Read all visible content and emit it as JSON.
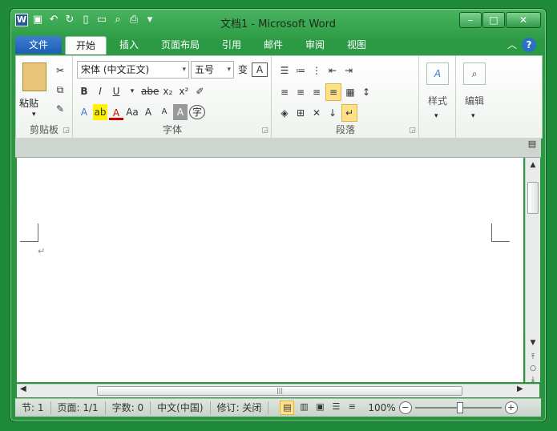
{
  "window": {
    "title": "文档1 - Microsoft Word",
    "minimize_icon": "minimize-icon",
    "maximize_icon": "maximize-icon",
    "close_icon": "close-icon"
  },
  "quick_access": {
    "app_icon": "W",
    "items": [
      "save-icon",
      "undo-icon",
      "redo-icon",
      "new-doc-icon",
      "open-icon",
      "print-preview-icon",
      "print-icon",
      "customize-icon"
    ]
  },
  "tabs": [
    {
      "label": "文件"
    },
    {
      "label": "开始"
    },
    {
      "label": "插入"
    },
    {
      "label": "页面布局"
    },
    {
      "label": "引用"
    },
    {
      "label": "邮件"
    },
    {
      "label": "审阅"
    },
    {
      "label": "视图"
    }
  ],
  "ribbon": {
    "clipboard": {
      "label": "剪贴板",
      "paste_label": "粘贴"
    },
    "font": {
      "label": "字体",
      "font_name": "宋体 (中文正文)",
      "font_size": "五号",
      "bold": "B",
      "italic": "I",
      "underline": "U",
      "strike": "abe",
      "subscript": "x₂",
      "superscript": "x²",
      "case": "Aa",
      "grow": "A",
      "shrink": "A",
      "char_border": "A",
      "enclose": "字"
    },
    "paragraph": {
      "label": "段落"
    },
    "styles": {
      "label": "样式"
    },
    "editing": {
      "label": "编辑"
    }
  },
  "document": {
    "paragraph_mark": "↵"
  },
  "status": {
    "section": "节: 1",
    "page": "页面: 1/1",
    "words": "字数: 0",
    "language": "中文(中国)",
    "track": "修订: 关闭",
    "zoom": "100%",
    "zoom_minus": "−",
    "zoom_plus": "+"
  }
}
